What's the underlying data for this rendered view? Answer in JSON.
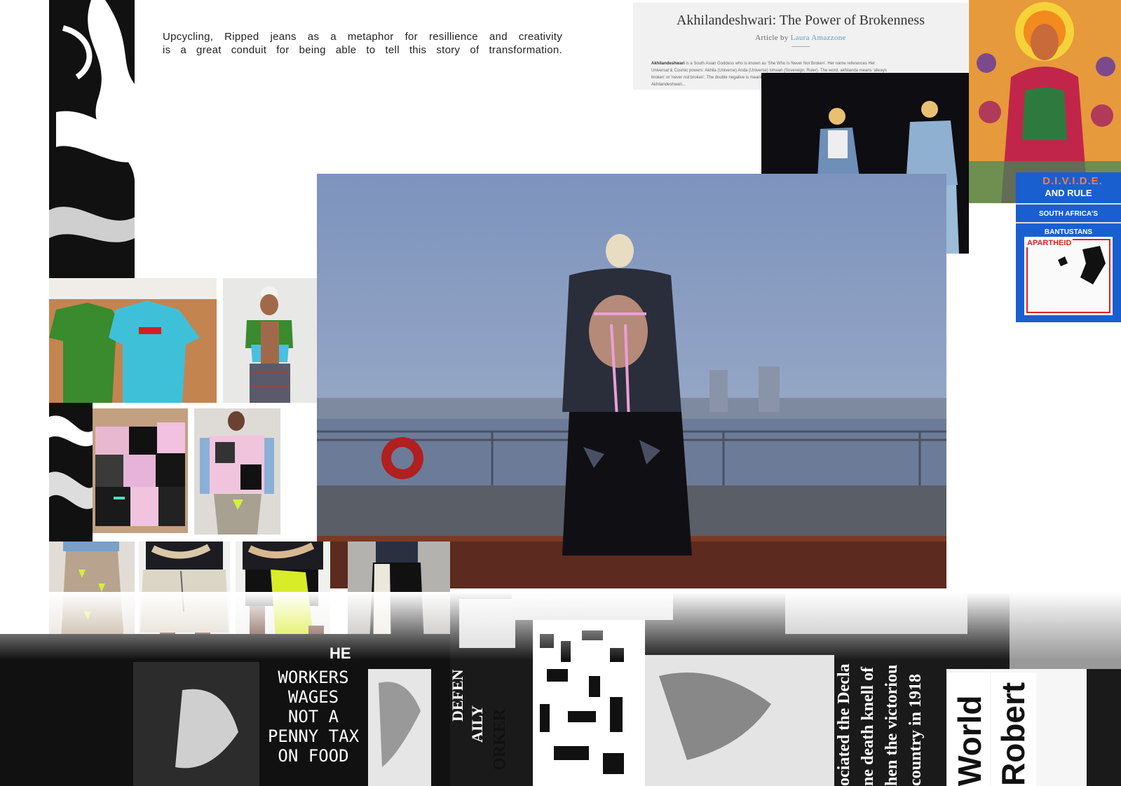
{
  "intro": {
    "line1": "Upcycling, Ripped jeans as  a metaphor for resillience and creativity",
    "line2": "is a great conduit for being able to tell this story of transformation."
  },
  "article": {
    "title": "Akhilandeshwari: The Power of Brokenness",
    "byline_prefix": "Article by",
    "author": "Laura Amazzone",
    "body_lead": "Akhilandeshwari",
    "body_text": "is a South Asian Goddess who is known as 'She Who Is Never Not Broken'. Her name references Her Universal & Cosmic powers: Akhila (Universe) Anda (Universe) Ishwari (Sovereign, Ruler). The word, akhilanda means 'always broken' or 'never not broken'. The double negative is meant to emphasize the truth... microcosm is the macrocosm and Akhilandeshwari..."
  },
  "poster": {
    "title": "D.I.V.I.D.E.",
    "sub1": "AND RULE",
    "sub2": "SOUTH AFRICA'S",
    "sub3": "BANTUSTANS",
    "stamp": "APARTHEID"
  },
  "collage": {
    "workers_lines": [
      "WORKERS",
      "WAGES",
      "NOT A",
      "PENNY TAX",
      "ON FOOD"
    ],
    "column_lines": [
      "ociated the Decla",
      "ne death knell of",
      "hen the victoriou",
      "country in 1918"
    ],
    "world": "World",
    "robert": "Robert",
    "defend": "DEFEN",
    "daily": "AILY",
    "worker": "ORKER",
    "he": "HE"
  },
  "colors": {
    "sky": "#8fa3c6",
    "article_bg": "#f1f1f1",
    "author_link": "#5a9fc2",
    "poster_blue": "#1a5fd0",
    "poster_orange": "#ff7a3a",
    "stamp_red": "#e01d1d"
  }
}
